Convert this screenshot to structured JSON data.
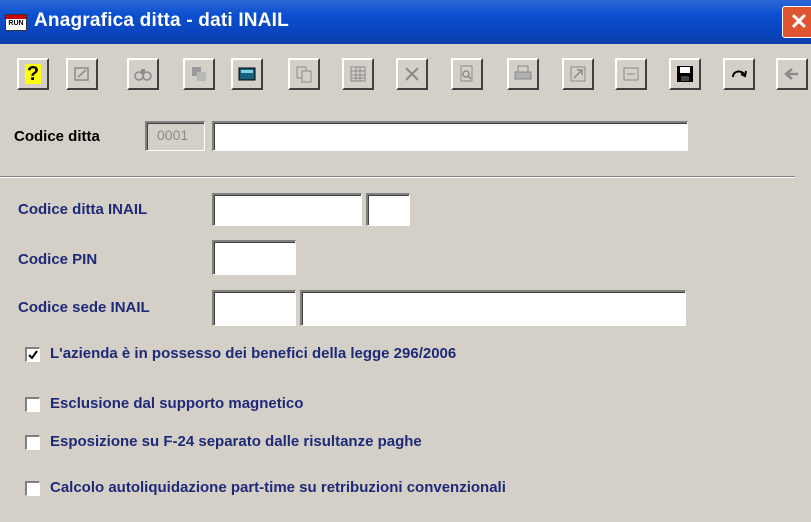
{
  "window": {
    "app_icon_text": "RUN",
    "title": "Anagrafica ditta - dati INAIL",
    "close_symbol": "✕"
  },
  "toolbar": {
    "buttons": [
      {
        "name": "help",
        "icon": "help-icon",
        "enabled": true
      },
      {
        "name": "properties",
        "icon": "properties-icon",
        "enabled": false
      },
      {
        "name": "search",
        "icon": "binoculars-icon",
        "enabled": false
      },
      {
        "name": "select",
        "icon": "select-icon",
        "enabled": false
      },
      {
        "name": "calculator",
        "icon": "calculator-icon",
        "enabled": true
      },
      {
        "name": "copy",
        "icon": "copy-icon",
        "enabled": false
      },
      {
        "name": "table",
        "icon": "table-icon",
        "enabled": false
      },
      {
        "name": "delete",
        "icon": "delete-icon",
        "enabled": false
      },
      {
        "name": "preview",
        "icon": "preview-icon",
        "enabled": false
      },
      {
        "name": "print",
        "icon": "print-icon",
        "enabled": false
      },
      {
        "name": "export",
        "icon": "export-icon",
        "enabled": false
      },
      {
        "name": "notes",
        "icon": "notes-icon",
        "enabled": false
      },
      {
        "name": "save",
        "icon": "save-icon",
        "enabled": true
      },
      {
        "name": "redo",
        "icon": "redo-icon",
        "enabled": true
      },
      {
        "name": "back",
        "icon": "back-arrow-icon",
        "enabled": false
      }
    ]
  },
  "form": {
    "codice_ditta_label": "Codice ditta",
    "codice_ditta_value": "0001",
    "ragione_sociale_value": "",
    "codice_ditta_inail_label": "Codice ditta INAIL",
    "codice_ditta_inail_value": "",
    "codice_ditta_inail_suffix": "",
    "codice_pin_label": "Codice PIN",
    "codice_pin_value": "",
    "codice_sede_inail_label": "Codice sede INAIL",
    "codice_sede_inail_value": "",
    "codice_sede_inail_desc": ""
  },
  "options": [
    {
      "label": "L'azienda è in possesso dei benefici della legge 296/2006",
      "checked": true
    },
    {
      "label": "Esclusione dal supporto magnetico",
      "checked": false
    },
    {
      "label": "Esposizione su F-24 separato dalle risultanze paghe",
      "checked": false
    },
    {
      "label": "Calcolo autoliquidazione part-time su retribuzioni convenzionali",
      "checked": false
    }
  ],
  "colors": {
    "title_bar": "#0a4fd0",
    "label_blue": "#1e2a78",
    "window_bg": "#d4d0c8",
    "close_button": "#e0552f"
  }
}
